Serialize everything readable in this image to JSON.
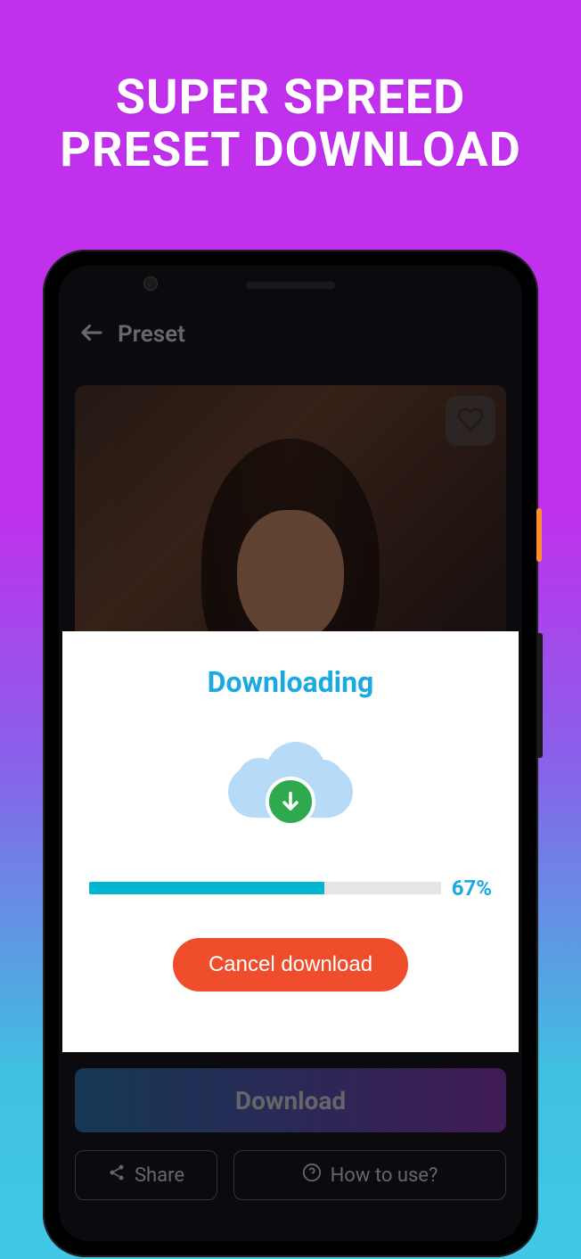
{
  "headline": {
    "line1": "SUPER SPREED",
    "line2": "PRESET DOWNLOAD"
  },
  "appbar": {
    "title": "Preset"
  },
  "dialog": {
    "title": "Downloading",
    "progress_percent": 67,
    "progress_label": "67%",
    "cancel_label": "Cancel download"
  },
  "actions": {
    "download_label": "Download",
    "share_label": "Share",
    "howto_label": "How to use?"
  }
}
